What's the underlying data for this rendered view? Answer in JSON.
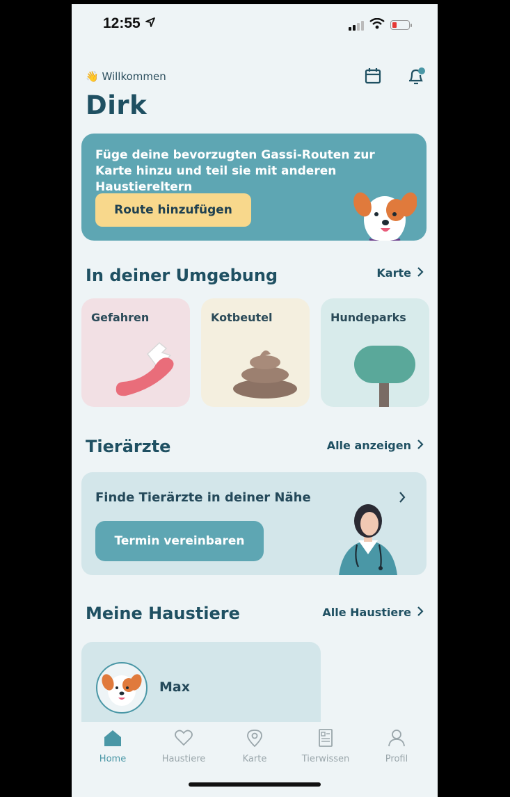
{
  "status_bar": {
    "time": "12:55"
  },
  "header": {
    "welcome": "Willkommen",
    "user_name": "Dirk"
  },
  "route_banner": {
    "text": "Füge deine bevorzugten Gassi-Routen zur Karte hinzu und teil sie mit anderen Haustiereltern",
    "button_label": "Route hinzufügen"
  },
  "nearby": {
    "title": "In deiner Umgebung",
    "link": "Karte",
    "tiles": [
      {
        "label": "Gefahren",
        "bg": "#f2e0e4"
      },
      {
        "label": "Kotbeutel",
        "bg": "#f4efdf"
      },
      {
        "label": "Hundeparks",
        "bg": "#d8ebeb"
      }
    ]
  },
  "vets": {
    "title": "Tierärzte",
    "link": "Alle anzeigen",
    "card_title": "Finde Tierärzte in deiner Nähe",
    "button_label": "Termin vereinbaren"
  },
  "pets": {
    "title": "Meine Haustiere",
    "link": "Alle Haustiere",
    "items": [
      {
        "name": "Max"
      }
    ]
  },
  "tab_bar": {
    "items": [
      {
        "label": "Home",
        "icon": "home-icon",
        "active": true
      },
      {
        "label": "Haustiere",
        "icon": "heart-icon",
        "active": false
      },
      {
        "label": "Karte",
        "icon": "map-pin-icon",
        "active": false
      },
      {
        "label": "Tierwissen",
        "icon": "article-icon",
        "active": false
      },
      {
        "label": "Profil",
        "icon": "profile-icon",
        "active": false
      }
    ]
  },
  "colors": {
    "accent": "#5ea6b3",
    "banner_button": "#f8d88c",
    "heading": "#1f5062",
    "background": "#eef4f6"
  }
}
